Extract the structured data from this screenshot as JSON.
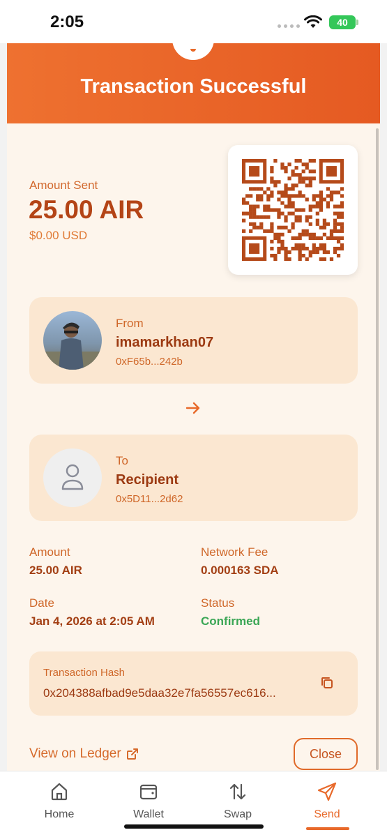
{
  "status_bar": {
    "time": "2:05",
    "battery": "40"
  },
  "header": {
    "title": "Transaction Successful"
  },
  "amount": {
    "label": "Amount Sent",
    "value": "25.00 AIR",
    "usd": "$0.00 USD"
  },
  "from": {
    "role": "From",
    "name": "imamarkhan07",
    "address": "0xF65b...242b"
  },
  "to": {
    "role": "To",
    "name": "Recipient",
    "address": "0x5D11...2d62"
  },
  "details": {
    "amount_label": "Amount",
    "amount_value": "25.00 AIR",
    "fee_label": "Network Fee",
    "fee_value": "0.000163 SDA",
    "date_label": "Date",
    "date_value": "Jan 4, 2026 at 2:05 AM",
    "status_label": "Status",
    "status_value": "Confirmed"
  },
  "hash": {
    "label": "Transaction Hash",
    "value": "0x204388afbad9e5daa32e7fa56557ec616..."
  },
  "actions": {
    "ledger_link": "View on Ledger",
    "close_label": "Close"
  },
  "tabs": [
    {
      "label": "Home",
      "icon": "home-icon"
    },
    {
      "label": "Wallet",
      "icon": "wallet-icon"
    },
    {
      "label": "Swap",
      "icon": "swap-icon"
    },
    {
      "label": "Send",
      "icon": "send-icon",
      "active": true
    }
  ],
  "colors": {
    "accent": "#e8692a",
    "header": "#ee7130",
    "success": "#3aa655",
    "card": "#fbe7d1",
    "background": "#fdf5ec"
  }
}
